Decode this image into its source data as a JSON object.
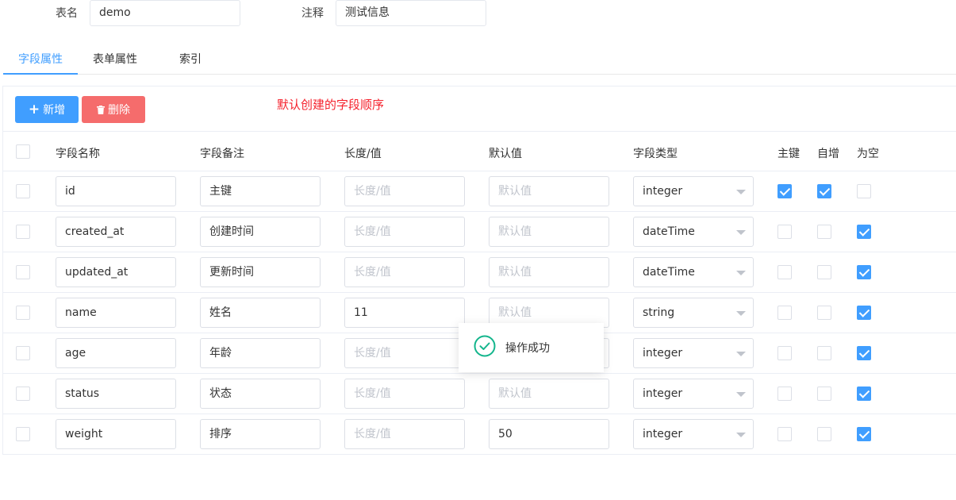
{
  "meta": {
    "table_label": "表名",
    "table_value": "demo",
    "comment_label": "注释",
    "comment_value": "测试信息"
  },
  "tabs": [
    {
      "label": "字段属性",
      "active": true
    },
    {
      "label": "表单属性",
      "active": false
    },
    {
      "label": "索引",
      "active": false
    }
  ],
  "toolbar": {
    "add_label": "新增",
    "delete_label": "删除",
    "note": "默认创建的字段顺序"
  },
  "columns": {
    "name": "字段名称",
    "comment": "字段备注",
    "length": "长度/值",
    "default": "默认值",
    "type": "字段类型",
    "primary": "主键",
    "auto_increment": "自增",
    "nullable": "为空"
  },
  "placeholders": {
    "length": "长度/值",
    "default": "默认值"
  },
  "rows": [
    {
      "name": "id",
      "comment": "主键",
      "length": "",
      "default": "",
      "type": "integer",
      "primary": true,
      "auto_increment": true,
      "nullable": false
    },
    {
      "name": "created_at",
      "comment": "创建时间",
      "length": "",
      "default": "",
      "type": "dateTime",
      "primary": false,
      "auto_increment": false,
      "nullable": true
    },
    {
      "name": "updated_at",
      "comment": "更新时间",
      "length": "",
      "default": "",
      "type": "dateTime",
      "primary": false,
      "auto_increment": false,
      "nullable": true
    },
    {
      "name": "name",
      "comment": "姓名",
      "length": "11",
      "default": "",
      "type": "string",
      "primary": false,
      "auto_increment": false,
      "nullable": true
    },
    {
      "name": "age",
      "comment": "年龄",
      "length": "",
      "default": "",
      "type": "integer",
      "primary": false,
      "auto_increment": false,
      "nullable": true
    },
    {
      "name": "status",
      "comment": "状态",
      "length": "",
      "default": "",
      "type": "integer",
      "primary": false,
      "auto_increment": false,
      "nullable": true
    },
    {
      "name": "weight",
      "comment": "排序",
      "length": "",
      "default": "50",
      "type": "integer",
      "primary": false,
      "auto_increment": false,
      "nullable": true
    }
  ],
  "toast": {
    "message": "操作成功",
    "icon": "check-circle-icon"
  },
  "colors": {
    "primary": "#409eff",
    "danger": "#f56c6c",
    "note": "#f5222d",
    "success": "#13b58c"
  }
}
